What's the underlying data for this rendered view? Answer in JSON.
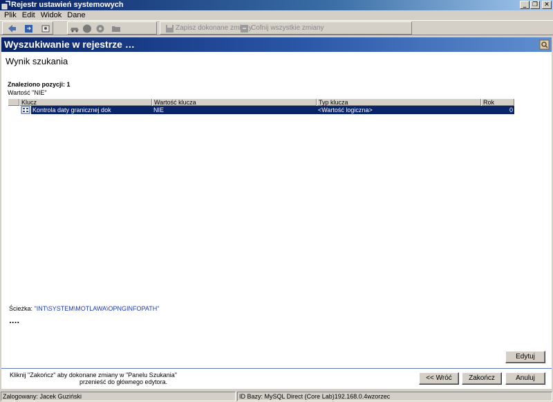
{
  "window": {
    "title": "Rejestr ustawień systemowych",
    "controls": [
      "_",
      "❐",
      "✕"
    ]
  },
  "menu": [
    {
      "label": "Plik",
      "accent": "P"
    },
    {
      "label": "Edit",
      "accent": "E"
    },
    {
      "label": "Widok",
      "accent": "W"
    },
    {
      "label": "Dane",
      "accent": "D"
    }
  ],
  "toolbar": {
    "save_label": "Zapisz dokonane zmiany",
    "undo_label": "Cofnij wszystkie zmiany",
    "icons": [
      "back-arrow-icon",
      "refresh-icon",
      "tools-icon",
      "car-icon",
      "circle-icon",
      "gear-icon",
      "folder-icon",
      "save-icon",
      "undo-icon"
    ]
  },
  "header": {
    "title": "Wyszukiwanie w rejestrze …"
  },
  "main": {
    "section_title": "Wynik szukania",
    "found_label": "Znaleziono pozycji: 1",
    "value_label": "Wartość \"NIE\"",
    "columns": [
      "Klucz",
      "Wartość klucza",
      "Typ klucza",
      "Rok"
    ],
    "rows": [
      {
        "key": "Kontrola daty granicznej dok",
        "value": "NIE",
        "type": "<Wartość logiczna>",
        "year": "0"
      }
    ],
    "path_label": "Ścieżka: ",
    "path_value": "\"INT\\SYSTEM\\MOTLAWA\\OPNGINFOPATH\"",
    "dots": "....",
    "edit_button": "Edytuj"
  },
  "footer": {
    "hint_line1": "Kliknij \"Zakończ\" aby dokonane zmiany w \"Panelu Szukania\"",
    "hint_line2": "przenieść do głównego edytora.",
    "back_button": "<< Wróć",
    "finish_button": "Zakończ",
    "cancel_button": "Anuluj"
  },
  "status": {
    "user": "Zalogowany: Jacek Guziński",
    "db": "ID Bazy: MySQL Direct (Core Lab)192.168.0.4wzorzec"
  },
  "colors": {
    "title_bar": "#0a246a",
    "selection": "#0a246a",
    "path_text": "#1e3ab0",
    "header": "#2b57a8"
  }
}
